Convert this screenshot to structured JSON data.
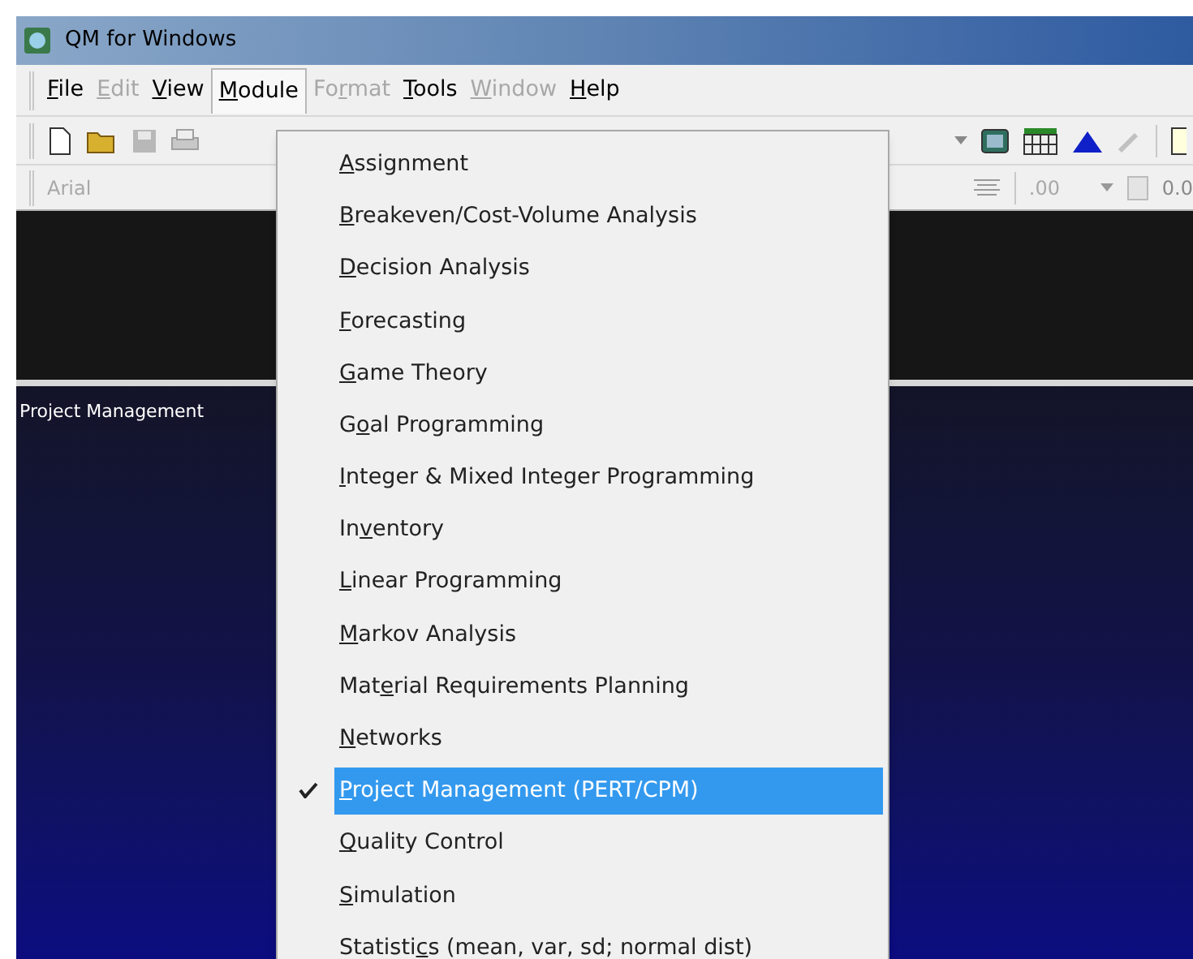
{
  "window": {
    "title": "QM for Windows"
  },
  "menu_bar": [
    {
      "key": "F",
      "post": "ile",
      "disabled": false,
      "selected": false
    },
    {
      "key": "E",
      "post": "dit",
      "disabled": true,
      "selected": false
    },
    {
      "key": "V",
      "post": "iew",
      "disabled": false,
      "selected": false
    },
    {
      "key": "M",
      "post": "odule",
      "disabled": false,
      "selected": true
    },
    {
      "pre": "Fo",
      "key": "r",
      "post": "mat",
      "disabled": true,
      "selected": false
    },
    {
      "key": "T",
      "post": "ools",
      "disabled": false,
      "selected": false
    },
    {
      "key": "W",
      "post": "indow",
      "disabled": true,
      "selected": false
    },
    {
      "key": "H",
      "post": "elp",
      "disabled": false,
      "selected": false
    }
  ],
  "format_bar": {
    "font": "Arial",
    "decimals": ".00",
    "value": "0.0"
  },
  "module_panel": {
    "title": "Project Management"
  },
  "module_menu": [
    {
      "key": "A",
      "post": "ssignment",
      "selected": false
    },
    {
      "key": "B",
      "post": "reakeven/Cost-Volume Analysis",
      "selected": false
    },
    {
      "key": "D",
      "post": "ecision Analysis",
      "selected": false
    },
    {
      "key": "F",
      "post": "orecasting",
      "selected": false
    },
    {
      "key": "G",
      "post": "ame Theory",
      "selected": false
    },
    {
      "pre": "G",
      "key": "o",
      "post": "al Programming",
      "selected": false
    },
    {
      "key": "I",
      "post": "nteger & Mixed Integer Programming",
      "selected": false
    },
    {
      "pre": "In",
      "key": "v",
      "post": "entory",
      "selected": false
    },
    {
      "key": "L",
      "post": "inear Programming",
      "selected": false
    },
    {
      "key": "M",
      "post": "arkov Analysis",
      "selected": false
    },
    {
      "pre": "Mat",
      "key": "e",
      "post": "rial Requirements Planning",
      "selected": false
    },
    {
      "key": "N",
      "post": "etworks",
      "selected": false
    },
    {
      "key": "P",
      "post": "roject Management (PERT/CPM)",
      "selected": true
    },
    {
      "key": "Q",
      "post": "uality Control",
      "selected": false
    },
    {
      "key": "S",
      "post": "imulation",
      "selected": false
    },
    {
      "pre": "Statisti",
      "key": "c",
      "post": "s (mean, var, sd; normal dist)",
      "selected": false
    }
  ]
}
